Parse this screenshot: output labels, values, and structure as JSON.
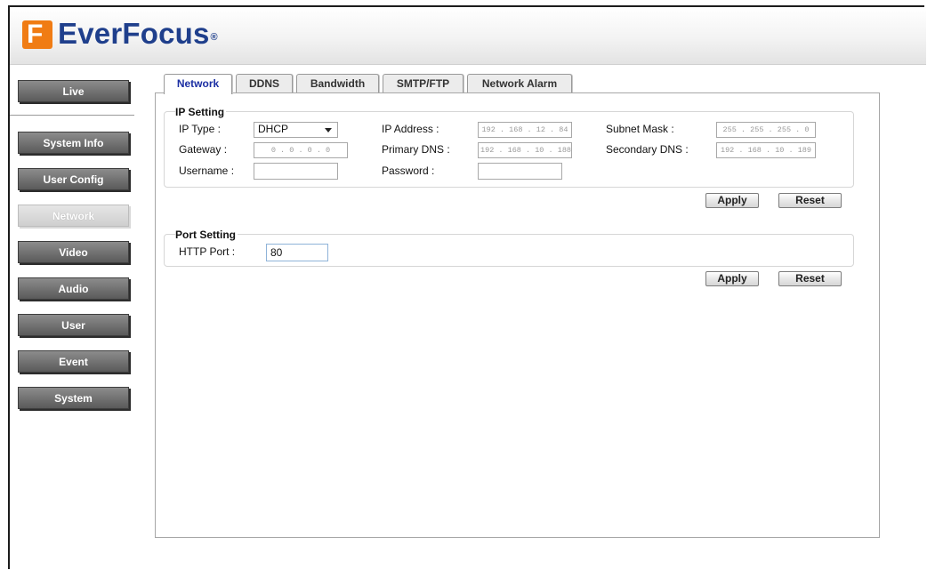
{
  "brand": {
    "name": "EverFocus",
    "mark": "F",
    "reg": "®"
  },
  "sidebar": {
    "items": [
      {
        "label": "Live"
      },
      {
        "label": "System Info"
      },
      {
        "label": "User Config"
      },
      {
        "label": "Network"
      },
      {
        "label": "Video"
      },
      {
        "label": "Audio"
      },
      {
        "label": "User"
      },
      {
        "label": "Event"
      },
      {
        "label": "System"
      }
    ]
  },
  "tabs": [
    {
      "label": "Network"
    },
    {
      "label": "DDNS"
    },
    {
      "label": "Bandwidth"
    },
    {
      "label": "SMTP/FTP"
    },
    {
      "label": "Network Alarm"
    }
  ],
  "ip_setting": {
    "title": "IP Setting",
    "ip_type": {
      "label": "IP Type :",
      "value": "DHCP"
    },
    "ip_address": {
      "label": "IP Address :",
      "value": "192 . 168 . 12 . 84"
    },
    "subnet_mask": {
      "label": "Subnet Mask :",
      "value": "255 . 255 . 255 . 0"
    },
    "gateway": {
      "label": "Gateway :",
      "value": "0 . 0 . 0 . 0"
    },
    "primary_dns": {
      "label": "Primary DNS :",
      "value": "192 . 168 . 10 . 188"
    },
    "secondary_dns": {
      "label": "Secondary DNS :",
      "value": "192 . 168 . 10 . 189"
    },
    "username": {
      "label": "Username :",
      "value": ""
    },
    "password": {
      "label": "Password :",
      "value": ""
    },
    "apply": "Apply",
    "reset": "Reset"
  },
  "port_setting": {
    "title": "Port Setting",
    "http_port": {
      "label": "HTTP Port :",
      "value": "80"
    },
    "apply": "Apply",
    "reset": "Reset"
  }
}
